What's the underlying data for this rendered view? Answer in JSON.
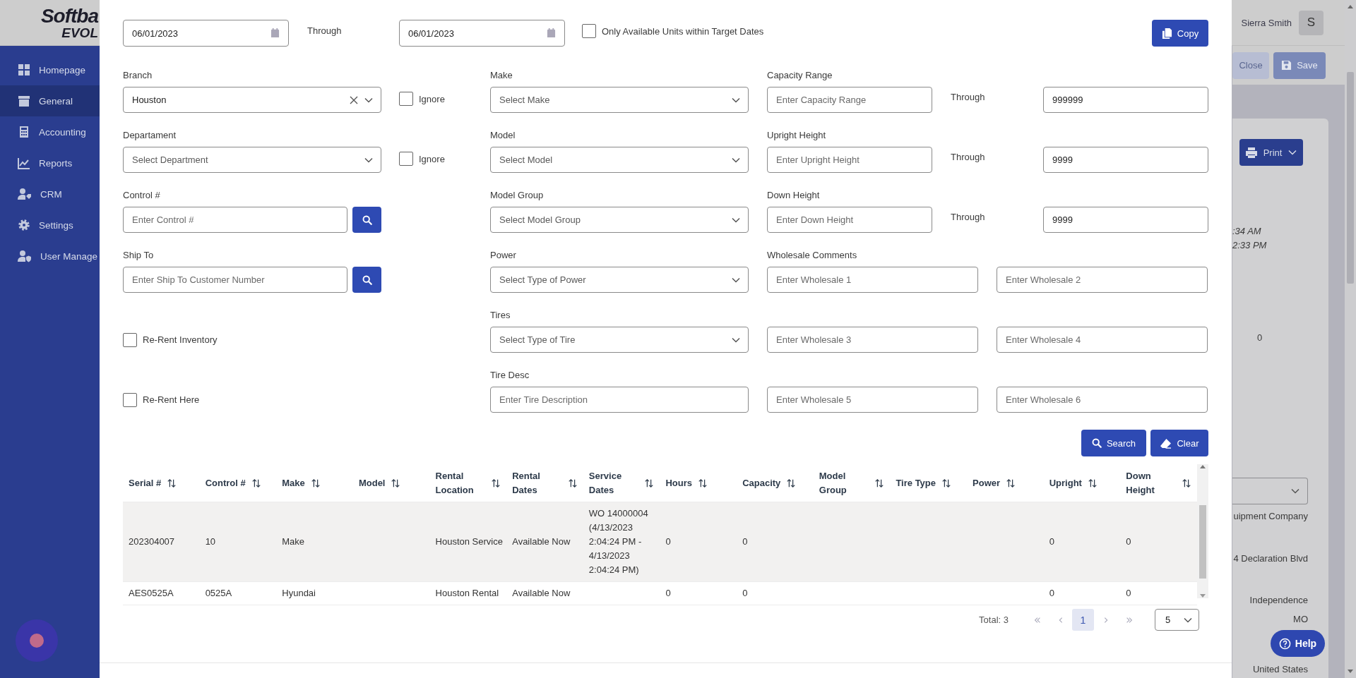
{
  "app": {
    "logo": {
      "line_1": "Softba",
      "line_2": "EVOL"
    },
    "sidebar": [
      {
        "label": "Homepage",
        "selected": false
      },
      {
        "label": "General",
        "selected": true
      },
      {
        "label": "Accounting",
        "selected": false
      },
      {
        "label": "Reports",
        "selected": false
      },
      {
        "label": "CRM",
        "selected": false
      },
      {
        "label": "Settings",
        "selected": false
      },
      {
        "label": "User Manage",
        "selected": false
      }
    ],
    "user": {
      "name": "Sierra Smith",
      "initial": "S"
    },
    "toolbar_buttons": [
      {
        "label": "Close",
        "kind": "secondary"
      },
      {
        "label": "Save",
        "kind": "primary"
      }
    ],
    "print_button": "Print",
    "timestamps": [
      ":34 AM",
      "2:33 PM"
    ],
    "count": "0",
    "company": "uipment Company",
    "address": [
      "4 Declaration Blvd",
      "Independence",
      "MO",
      "United States"
    ],
    "help_button": "Help"
  },
  "modal": {
    "date_from": "06/01/2023",
    "through": "Through",
    "date_to": "06/01/2023",
    "available_only": {
      "label": "Only Available Units within Target Dates",
      "checked": false
    },
    "copy_button": "Copy",
    "filters": {
      "left": [
        {
          "kind": "select",
          "label": "Branch",
          "value": "Houston",
          "clearable": true,
          "ignore": {
            "label": "Ignore",
            "checked": false
          }
        },
        {
          "kind": "select",
          "label": "Departament",
          "placeholder": "Select Department",
          "clearable": false,
          "ignore": {
            "label": "Ignore",
            "checked": false
          }
        },
        {
          "kind": "lookup",
          "label": "Control #",
          "placeholder": "Enter Control #"
        },
        {
          "kind": "lookup",
          "label": "Ship To",
          "placeholder": "Enter Ship To Customer Number"
        },
        {
          "kind": "checkbox",
          "label": "Re-Rent Inventory",
          "checked": false
        },
        {
          "kind": "checkbox",
          "label": "Re-Rent Here",
          "checked": false
        }
      ],
      "middle": [
        {
          "kind": "select",
          "label": "Make",
          "placeholder": "Select Make",
          "clearable": false
        },
        {
          "kind": "select",
          "label": "Model",
          "placeholder": "Select Model",
          "clearable": false
        },
        {
          "kind": "select",
          "label": "Model Group",
          "placeholder": "Select Model Group",
          "clearable": false
        },
        {
          "kind": "select",
          "label": "Power",
          "placeholder": "Select Type of Power",
          "clearable": false
        },
        {
          "kind": "select",
          "label": "Tires",
          "placeholder": "Select Type of Tire",
          "clearable": false
        },
        {
          "kind": "text",
          "label": "Tire Desc",
          "placeholder": "Enter Tire Description"
        }
      ],
      "right": [
        {
          "kind": "range",
          "label": "Capacity Range",
          "from": {
            "placeholder": "Enter Capacity Range"
          },
          "through": "Through",
          "to": {
            "value": "999999"
          }
        },
        {
          "kind": "range",
          "label": "Upright Height",
          "from": {
            "placeholder": "Enter Upright Height"
          },
          "through": "Through",
          "to": {
            "value": "9999"
          }
        },
        {
          "kind": "range",
          "label": "Down Height",
          "from": {
            "placeholder": "Enter Down Height"
          },
          "through": "Through",
          "to": {
            "value": "9999"
          }
        },
        {
          "kind": "pair",
          "label": "Wholesale Comments",
          "fields": [
            {
              "placeholder": "Enter Wholesale 1"
            },
            {
              "placeholder": "Enter Wholesale 2"
            }
          ]
        },
        {
          "kind": "pair",
          "fields": [
            {
              "placeholder": "Enter Wholesale 3"
            },
            {
              "placeholder": "Enter Wholesale 4"
            }
          ]
        },
        {
          "kind": "pair",
          "fields": [
            {
              "placeholder": "Enter Wholesale 5"
            },
            {
              "placeholder": "Enter Wholesale 6"
            }
          ]
        }
      ]
    },
    "search_button": "Search",
    "clear_button": "Clear",
    "table": {
      "columns": [
        "Serial #",
        "Control #",
        "Make",
        "Model",
        "Rental Location",
        "Rental Dates",
        "Service Dates",
        "Hours",
        "Capacity",
        "Model Group",
        "Tire Type",
        "Power",
        "Upright",
        "Down Height"
      ],
      "rows": [
        {
          "selected": true,
          "cells": [
            "202304007",
            "10",
            "Make",
            null,
            "Houston Service",
            "Available Now",
            "WO 14000004 (4/13/2023 2:04:24 PM - 4/13/2023 2:04:24 PM)",
            "0",
            "0",
            null,
            null,
            null,
            "0",
            "0"
          ]
        },
        {
          "selected": false,
          "cells": [
            "AES0525A",
            "0525A",
            "Hyundai",
            null,
            "Houston Rental",
            "Available Now",
            null,
            "0",
            "0",
            null,
            null,
            null,
            "0",
            "0"
          ]
        }
      ]
    },
    "pager": {
      "total": "Total: 3",
      "pages": [
        {
          "label": "1",
          "selected": true
        }
      ],
      "page_size": "5"
    }
  }
}
